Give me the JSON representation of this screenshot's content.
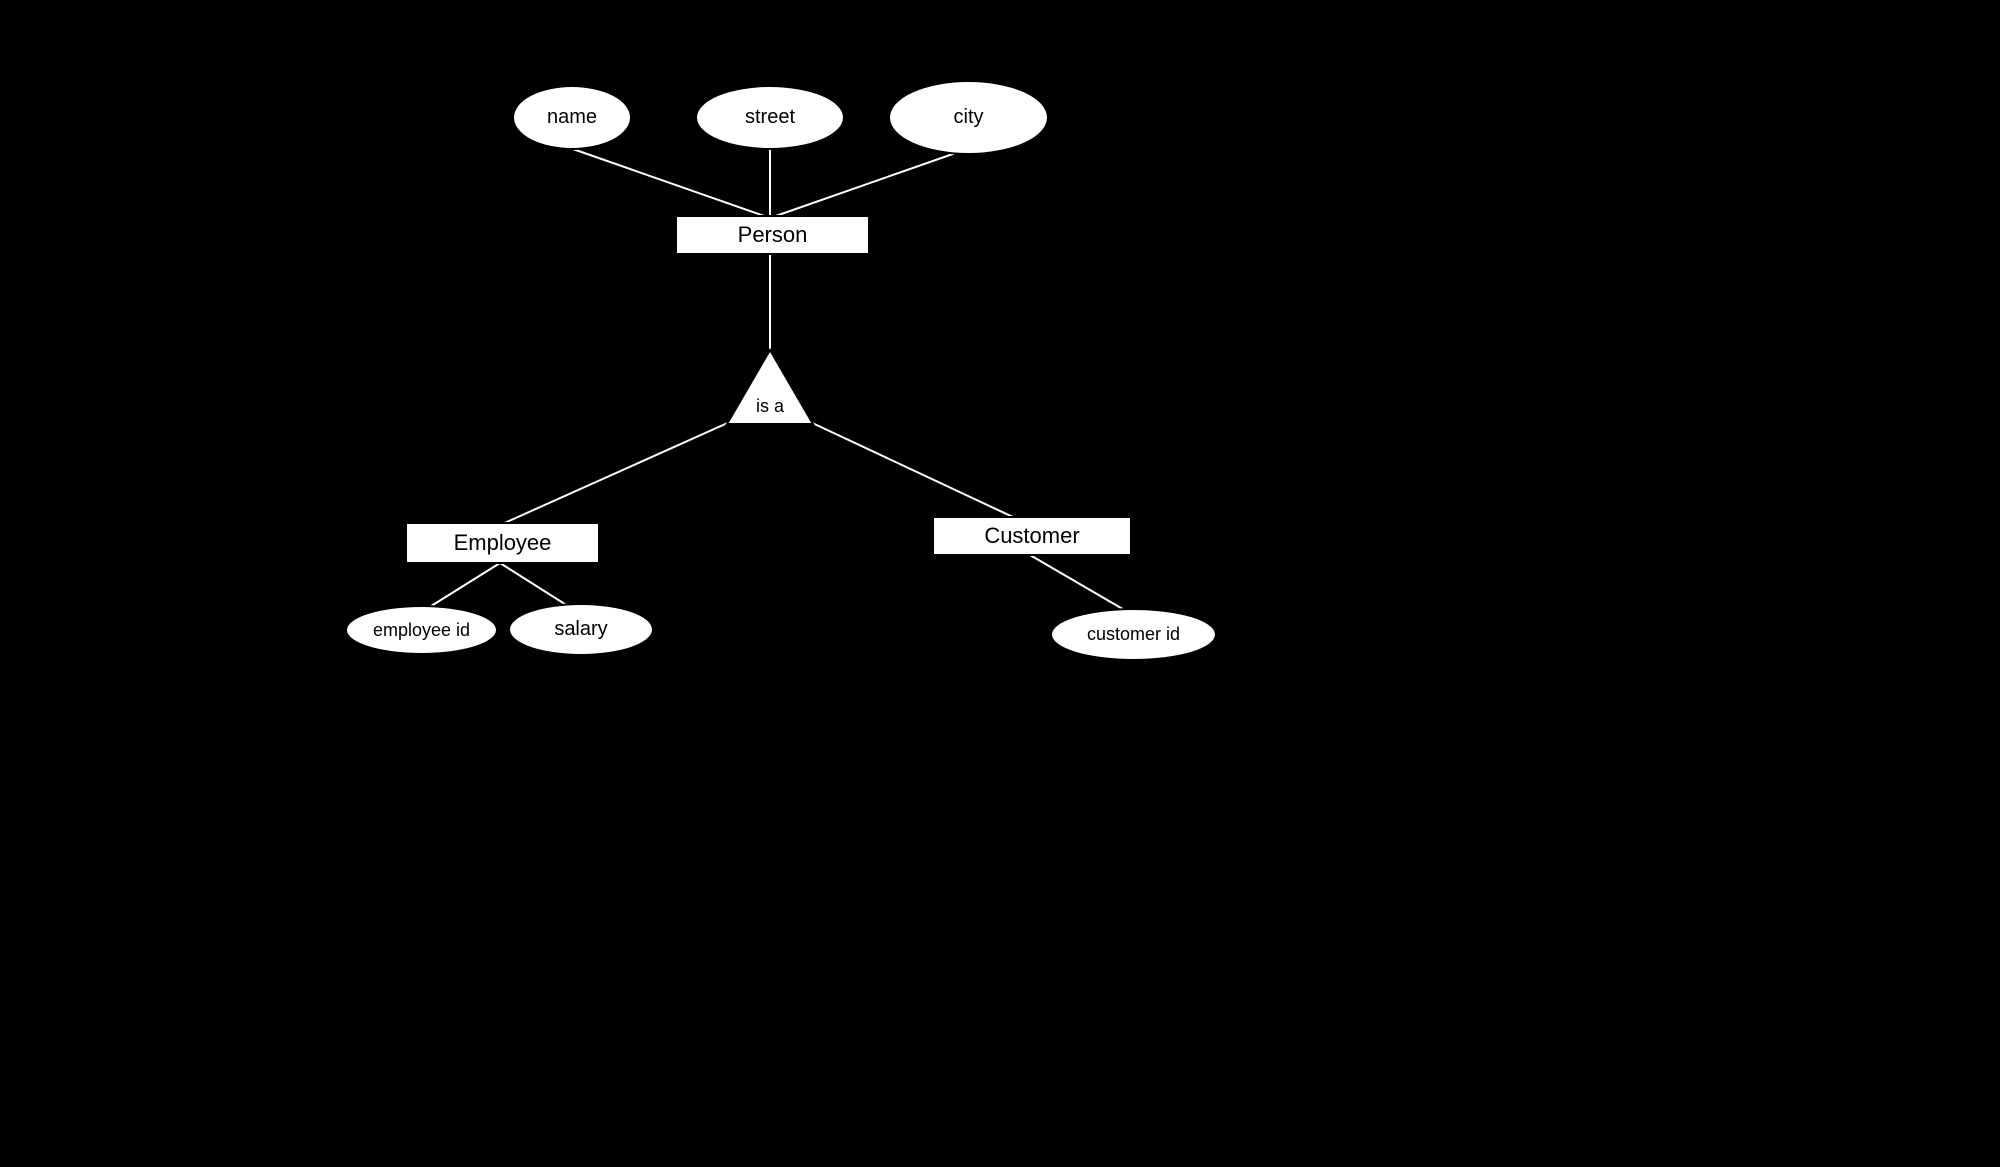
{
  "diagram": {
    "entities": {
      "person": "Person",
      "employee": "Employee",
      "customer": "Customer"
    },
    "relationship": {
      "isa": "is a"
    },
    "attributes": {
      "name": "name",
      "street": "street",
      "city": "city",
      "employee_id": "employee id",
      "salary": "salary",
      "customer_id": "customer id"
    }
  }
}
